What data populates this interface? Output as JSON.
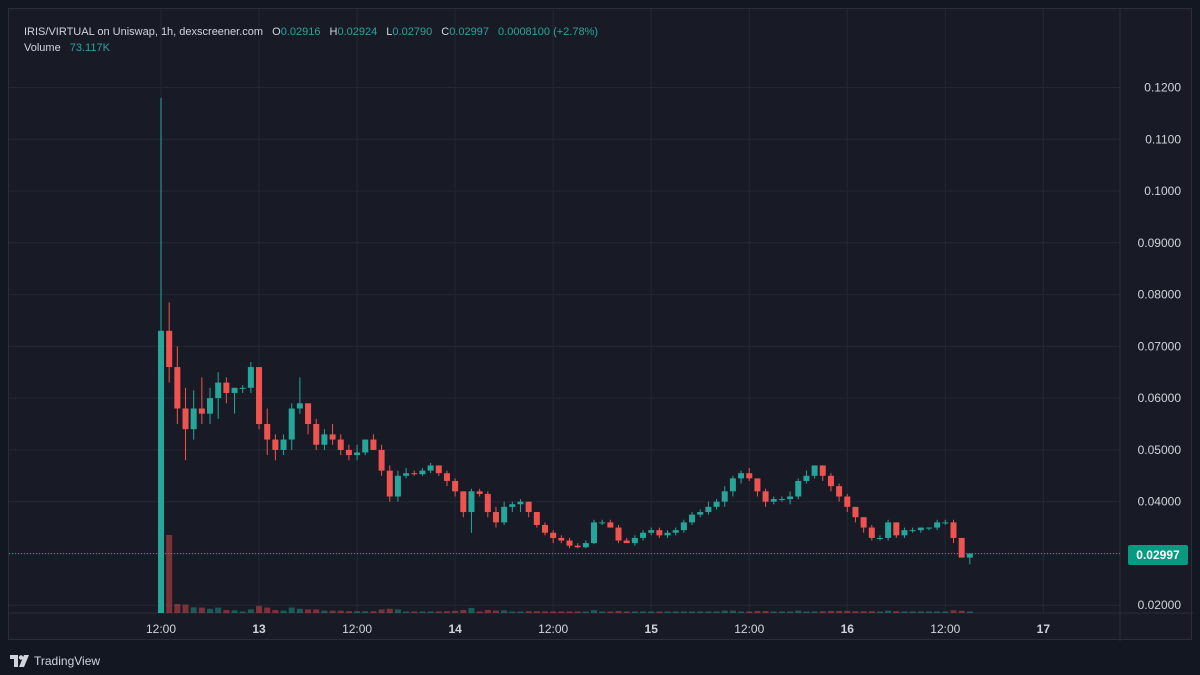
{
  "legend": {
    "title": "IRIS/VIRTUAL on Uniswap, 1h, dexscreener.com",
    "o_label": "O",
    "o_value": "0.02916",
    "h_label": "H",
    "h_value": "0.02924",
    "l_label": "L",
    "l_value": "0.02790",
    "c_label": "C",
    "c_value": "0.02997",
    "change": "0.0008100 (+2.78%)",
    "volume_label": "Volume",
    "volume_value": "73.117K"
  },
  "current_price": "0.02997",
  "brand": "TradingView",
  "colors": {
    "up": "#26a69a",
    "down": "#ef5350",
    "background": "#181b25",
    "grid": "#242733",
    "text": "#d1d4dc",
    "badge": "#089981"
  },
  "chart_data": {
    "type": "candlestick",
    "ylim": [
      0.0185,
      0.1255
    ],
    "yticks": [
      "0.02000",
      "0.03000",
      "0.04000",
      "0.05000",
      "0.06000",
      "0.07000",
      "0.08000",
      "0.09000",
      "0.1000",
      "0.1100",
      "0.1200"
    ],
    "xticks": [
      {
        "hour": 0,
        "label": "12:00"
      },
      {
        "hour": 12,
        "label": "13"
      },
      {
        "hour": 24,
        "label": "12:00"
      },
      {
        "hour": 36,
        "label": "14"
      },
      {
        "hour": 48,
        "label": "12:00"
      },
      {
        "hour": 60,
        "label": "15"
      },
      {
        "hour": 72,
        "label": "12:00"
      },
      {
        "hour": 84,
        "label": "16"
      },
      {
        "hour": 96,
        "label": "12:00"
      },
      {
        "hour": 108,
        "label": "17"
      }
    ],
    "candles": [
      [
        0.0185,
        0.118,
        0.0185,
        0.073
      ],
      [
        0.073,
        0.0785,
        0.063,
        0.066
      ],
      [
        0.066,
        0.07,
        0.055,
        0.058
      ],
      [
        0.058,
        0.062,
        0.048,
        0.054
      ],
      [
        0.054,
        0.0615,
        0.052,
        0.058
      ],
      [
        0.058,
        0.064,
        0.055,
        0.057
      ],
      [
        0.057,
        0.062,
        0.055,
        0.06
      ],
      [
        0.06,
        0.065,
        0.056,
        0.063
      ],
      [
        0.063,
        0.064,
        0.059,
        0.061
      ],
      [
        0.061,
        0.0615,
        0.057,
        0.062
      ],
      [
        0.062,
        0.0625,
        0.061,
        0.062
      ],
      [
        0.062,
        0.067,
        0.061,
        0.066
      ],
      [
        0.066,
        0.066,
        0.054,
        0.055
      ],
      [
        0.055,
        0.058,
        0.049,
        0.052
      ],
      [
        0.052,
        0.053,
        0.048,
        0.05
      ],
      [
        0.05,
        0.053,
        0.049,
        0.052
      ],
      [
        0.052,
        0.059,
        0.05,
        0.058
      ],
      [
        0.058,
        0.064,
        0.057,
        0.059
      ],
      [
        0.059,
        0.059,
        0.053,
        0.055
      ],
      [
        0.055,
        0.056,
        0.05,
        0.051
      ],
      [
        0.051,
        0.054,
        0.05,
        0.053
      ],
      [
        0.053,
        0.055,
        0.051,
        0.052
      ],
      [
        0.052,
        0.053,
        0.049,
        0.05
      ],
      [
        0.05,
        0.051,
        0.048,
        0.049
      ],
      [
        0.049,
        0.051,
        0.048,
        0.0495
      ],
      [
        0.0495,
        0.052,
        0.049,
        0.052
      ],
      [
        0.052,
        0.053,
        0.05,
        0.05
      ],
      [
        0.05,
        0.051,
        0.045,
        0.046
      ],
      [
        0.046,
        0.047,
        0.04,
        0.041
      ],
      [
        0.041,
        0.046,
        0.04,
        0.045
      ],
      [
        0.045,
        0.0465,
        0.0445,
        0.0455
      ],
      [
        0.0455,
        0.046,
        0.045,
        0.0453
      ],
      [
        0.0453,
        0.0465,
        0.045,
        0.046
      ],
      [
        0.046,
        0.0475,
        0.0455,
        0.047
      ],
      [
        0.047,
        0.047,
        0.045,
        0.0455
      ],
      [
        0.0455,
        0.046,
        0.043,
        0.044
      ],
      [
        0.044,
        0.0445,
        0.041,
        0.042
      ],
      [
        0.042,
        0.042,
        0.037,
        0.038
      ],
      [
        0.038,
        0.0425,
        0.034,
        0.042
      ],
      [
        0.042,
        0.0425,
        0.041,
        0.0415
      ],
      [
        0.0415,
        0.042,
        0.037,
        0.038
      ],
      [
        0.038,
        0.039,
        0.035,
        0.036
      ],
      [
        0.036,
        0.04,
        0.0355,
        0.039
      ],
      [
        0.039,
        0.04,
        0.038,
        0.0395
      ],
      [
        0.0395,
        0.0405,
        0.038,
        0.04
      ],
      [
        0.04,
        0.04,
        0.037,
        0.038
      ],
      [
        0.038,
        0.038,
        0.035,
        0.0355
      ],
      [
        0.0355,
        0.036,
        0.0335,
        0.034
      ],
      [
        0.034,
        0.0345,
        0.032,
        0.033
      ],
      [
        0.033,
        0.0335,
        0.032,
        0.0325
      ],
      [
        0.0325,
        0.033,
        0.031,
        0.0315
      ],
      [
        0.0315,
        0.032,
        0.031,
        0.0312
      ],
      [
        0.0312,
        0.0325,
        0.031,
        0.032
      ],
      [
        0.032,
        0.0365,
        0.0318,
        0.036
      ],
      [
        0.036,
        0.0365,
        0.0355,
        0.036
      ],
      [
        0.036,
        0.0365,
        0.035,
        0.035
      ],
      [
        0.035,
        0.0355,
        0.032,
        0.0325
      ],
      [
        0.0325,
        0.033,
        0.032,
        0.032
      ],
      [
        0.032,
        0.0335,
        0.0315,
        0.033
      ],
      [
        0.033,
        0.0345,
        0.0325,
        0.034
      ],
      [
        0.034,
        0.035,
        0.0335,
        0.0345
      ],
      [
        0.0345,
        0.035,
        0.033,
        0.0335
      ],
      [
        0.0335,
        0.0345,
        0.033,
        0.034
      ],
      [
        0.034,
        0.035,
        0.0335,
        0.0345
      ],
      [
        0.0345,
        0.0365,
        0.034,
        0.036
      ],
      [
        0.036,
        0.038,
        0.0355,
        0.0375
      ],
      [
        0.0375,
        0.0385,
        0.037,
        0.038
      ],
      [
        0.038,
        0.04,
        0.0375,
        0.039
      ],
      [
        0.039,
        0.0405,
        0.0385,
        0.04
      ],
      [
        0.04,
        0.043,
        0.039,
        0.042
      ],
      [
        0.042,
        0.045,
        0.041,
        0.0445
      ],
      [
        0.0445,
        0.046,
        0.0435,
        0.0455
      ],
      [
        0.0455,
        0.0465,
        0.044,
        0.0445
      ],
      [
        0.0445,
        0.0445,
        0.041,
        0.042
      ],
      [
        0.042,
        0.0425,
        0.039,
        0.04
      ],
      [
        0.04,
        0.041,
        0.0395,
        0.0405
      ],
      [
        0.0405,
        0.041,
        0.04,
        0.0405
      ],
      [
        0.0405,
        0.042,
        0.0395,
        0.041
      ],
      [
        0.041,
        0.0445,
        0.0405,
        0.044
      ],
      [
        0.044,
        0.046,
        0.0435,
        0.045
      ],
      [
        0.045,
        0.047,
        0.0445,
        0.047
      ],
      [
        0.047,
        0.047,
        0.044,
        0.045
      ],
      [
        0.045,
        0.0455,
        0.042,
        0.043
      ],
      [
        0.043,
        0.0435,
        0.04,
        0.041
      ],
      [
        0.041,
        0.0415,
        0.038,
        0.039
      ],
      [
        0.039,
        0.039,
        0.036,
        0.037
      ],
      [
        0.037,
        0.037,
        0.034,
        0.035
      ],
      [
        0.035,
        0.0355,
        0.0325,
        0.033
      ],
      [
        0.033,
        0.0335,
        0.0325,
        0.033
      ],
      [
        0.033,
        0.0365,
        0.0325,
        0.036
      ],
      [
        0.036,
        0.036,
        0.033,
        0.0335
      ],
      [
        0.0335,
        0.035,
        0.033,
        0.0345
      ],
      [
        0.0345,
        0.035,
        0.034,
        0.0345
      ],
      [
        0.0345,
        0.035,
        0.034,
        0.035
      ],
      [
        0.035,
        0.035,
        0.0345,
        0.035
      ],
      [
        0.035,
        0.0365,
        0.0345,
        0.036
      ],
      [
        0.036,
        0.0365,
        0.0355,
        0.036
      ],
      [
        0.036,
        0.0365,
        0.032,
        0.033
      ],
      [
        0.033,
        0.033,
        0.0293,
        0.0292
      ],
      [
        0.0292,
        0.0301,
        0.0279,
        0.02997
      ]
    ]
  }
}
